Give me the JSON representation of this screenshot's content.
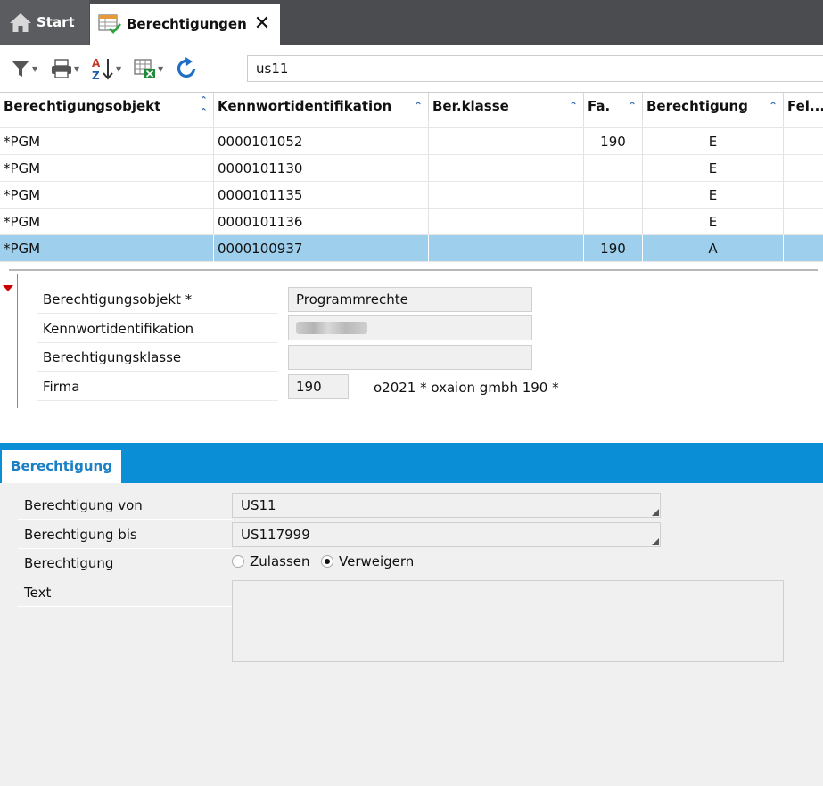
{
  "tabs": {
    "start_label": "Start",
    "active_label": "Berechtigungen"
  },
  "toolbar": {
    "search_value": "us11",
    "icons": [
      "filter-icon",
      "print-icon",
      "sort-az-icon",
      "excel-export-icon",
      "refresh-icon"
    ]
  },
  "grid": {
    "columns": [
      "Berechtigungsobjekt",
      "Kennwortidentifikation",
      "Ber.klasse",
      "Fa.",
      "Berechtigung",
      "Fel..."
    ],
    "rows": [
      {
        "obj": "*PGM",
        "kenn": "0000101052",
        "klasse": "",
        "fa": "190",
        "ber": "E",
        "fel": ""
      },
      {
        "obj": "*PGM",
        "kenn": "0000101130",
        "klasse": "",
        "fa": "",
        "ber": "E",
        "fel": ""
      },
      {
        "obj": "*PGM",
        "kenn": "0000101135",
        "klasse": "",
        "fa": "",
        "ber": "E",
        "fel": ""
      },
      {
        "obj": "*PGM",
        "kenn": "0000101136",
        "klasse": "",
        "fa": "",
        "ber": "E",
        "fel": ""
      },
      {
        "obj": "*PGM",
        "kenn": "0000100937",
        "klasse": "",
        "fa": "190",
        "ber": "A",
        "fel": "",
        "selected": true
      }
    ]
  },
  "detail": {
    "obj_label": "Berechtigungsobjekt *",
    "obj_value": "Programmrechte",
    "kenn_label": "Kennwortidentifikation",
    "klasse_label": "Berechtigungsklasse",
    "klasse_value": "",
    "firma_label": "Firma",
    "firma_value": "190",
    "firma_desc": "o2021 * oxaion gmbh  190 *"
  },
  "berechtigung_tab": {
    "tab_label": "Berechtigung",
    "von_label": "Berechtigung von",
    "von_value": "US11",
    "bis_label": "Berechtigung bis",
    "bis_value": "US117999",
    "ber_label": "Berechtigung",
    "option_zulassen": "Zulassen",
    "option_verweigern": "Verweigern",
    "selected_option": "Verweigern",
    "text_label": "Text",
    "text_value": ""
  },
  "colors": {
    "tabbar": "#4a4c50",
    "selected_row": "#9ed0ed",
    "band": "#0a8ed6",
    "sort_arrow": "#3a6fb5"
  }
}
